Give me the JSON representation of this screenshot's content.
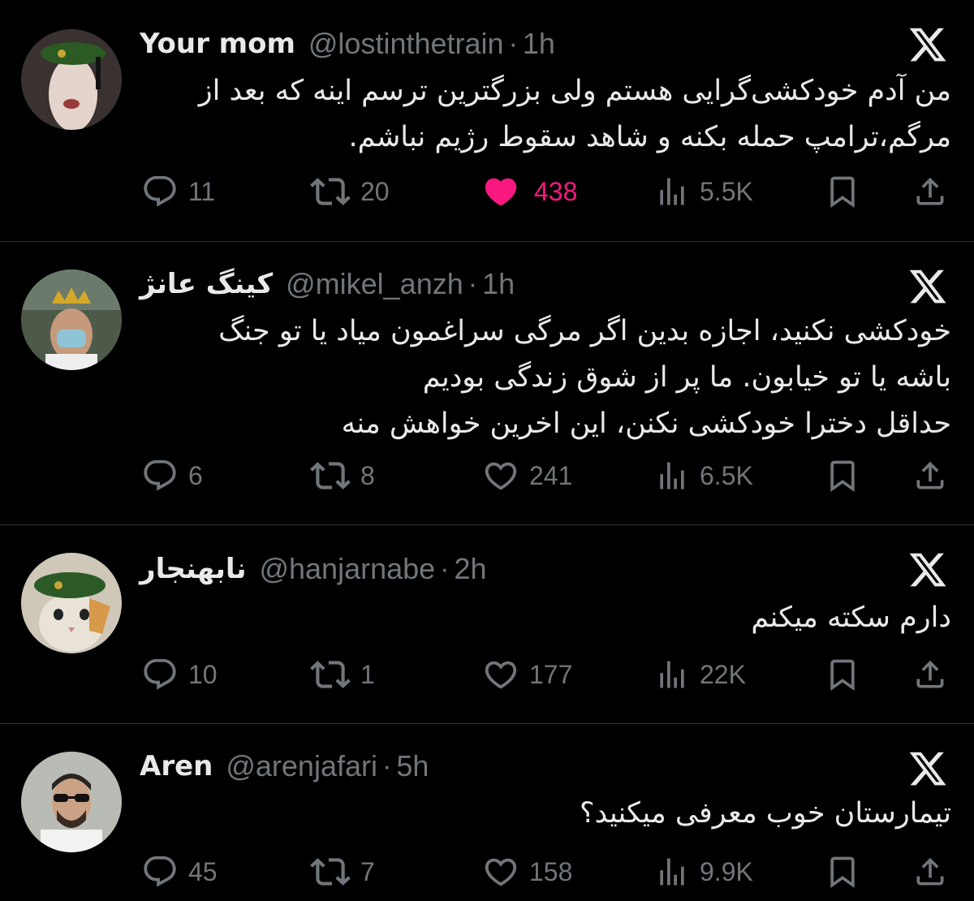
{
  "colors": {
    "background": "#000000",
    "text_primary": "#e7e9ea",
    "text_secondary": "#71767b",
    "like_active": "#f91880",
    "divider": "#2f3336"
  },
  "tweets": [
    {
      "name": "Your mom",
      "handle": "@lostinthetrain",
      "separator": "·",
      "time": "1h",
      "lines": [
        "من آدم خودکشی‌گرایی هستم ولی بزرگترین ترسم اینه که بعد از",
        "مرگم،ترامپ حمله بکنه و شاهد سقوط رژیم نباشم."
      ],
      "replies": "11",
      "reposts": "20",
      "likes": "438",
      "liked": true,
      "views": "5.5K",
      "icons": [
        "reply-icon",
        "repost-icon",
        "heart-icon",
        "views-icon",
        "bookmark-icon",
        "share-icon",
        "x-logo-icon"
      ]
    },
    {
      "name": "کینگ عانژ",
      "handle": "@mikel_anzh",
      "separator": "·",
      "time": "1h",
      "lines": [
        "خودکشی نکنید، اجازه بدین اگر مرگی سراغمون میاد یا تو جنگ",
        "باشه یا تو خیابون. ما پر از شوق زندگی بودیم",
        "حداقل دخترا خودکشی نکنن، این اخرین خواهش منه"
      ],
      "replies": "6",
      "reposts": "8",
      "likes": "241",
      "liked": false,
      "views": "6.5K"
    },
    {
      "name": "نابهنجار",
      "handle": "@hanjarnabe",
      "separator": "·",
      "time": "2h",
      "lines": [
        "دارم سکته میکنم"
      ],
      "replies": "10",
      "reposts": "1",
      "likes": "177",
      "liked": false,
      "views": "22K"
    },
    {
      "name": "Aren",
      "handle": "@arenjafari",
      "separator": "·",
      "time": "5h",
      "lines": [
        "تیمارستان خوب معرفی میکنید؟"
      ],
      "replies": "45",
      "reposts": "7",
      "likes": "158",
      "liked": false,
      "views": "9.9K"
    }
  ]
}
